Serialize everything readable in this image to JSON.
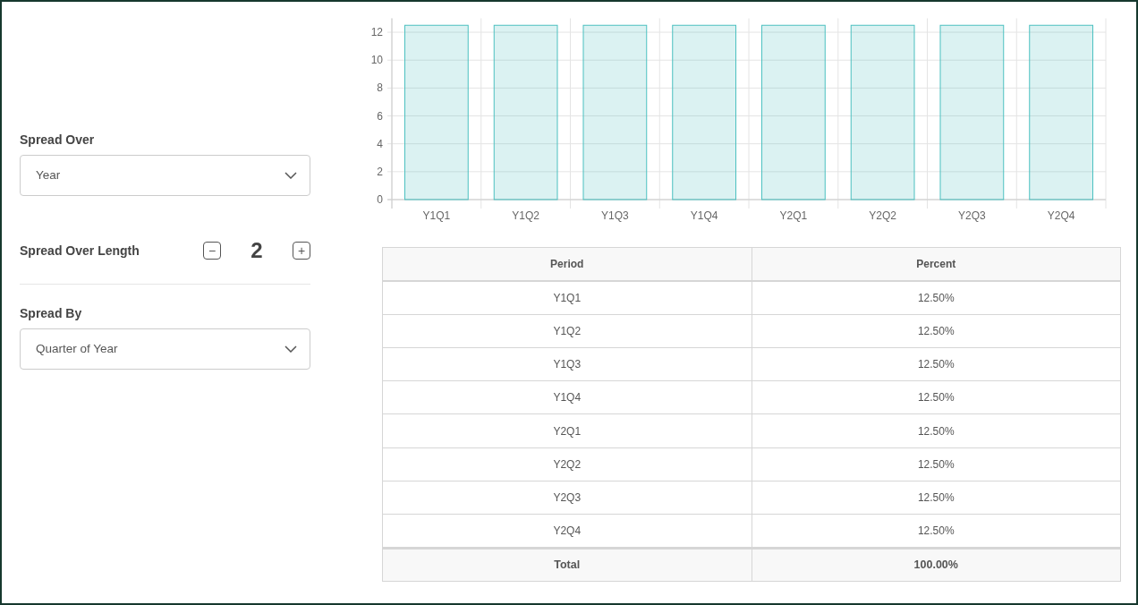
{
  "form": {
    "spread_over": {
      "label": "Spread Over",
      "value": "Year"
    },
    "spread_over_length": {
      "label": "Spread Over Length",
      "decrement": "−",
      "value": "2",
      "increment": "+"
    },
    "spread_by": {
      "label": "Spread By",
      "value": "Quarter of Year"
    }
  },
  "chart": {
    "chart_data": {
      "type": "bar",
      "categories": [
        "Y1Q1",
        "Y1Q2",
        "Y1Q3",
        "Y1Q4",
        "Y2Q1",
        "Y2Q2",
        "Y2Q3",
        "Y2Q4"
      ],
      "values": [
        12.5,
        12.5,
        12.5,
        12.5,
        12.5,
        12.5,
        12.5,
        12.5
      ],
      "grid": true,
      "ylim": [
        0,
        13
      ],
      "yticks": [
        0,
        2,
        4,
        6,
        8,
        10,
        12
      ]
    }
  },
  "table": {
    "columns": [
      "Period",
      "Percent"
    ],
    "rows": [
      [
        "Y1Q1",
        "12.50%"
      ],
      [
        "Y1Q2",
        "12.50%"
      ],
      [
        "Y1Q3",
        "12.50%"
      ],
      [
        "Y1Q4",
        "12.50%"
      ],
      [
        "Y2Q1",
        "12.50%"
      ],
      [
        "Y2Q2",
        "12.50%"
      ],
      [
        "Y2Q3",
        "12.50%"
      ],
      [
        "Y2Q4",
        "12.50%"
      ]
    ],
    "total": [
      "Total",
      "100.00%"
    ]
  }
}
